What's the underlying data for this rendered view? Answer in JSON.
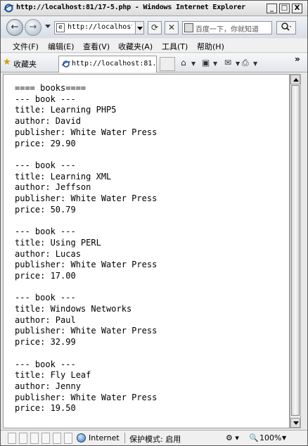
{
  "window": {
    "title": "http://localhost:81/17-5.php - Windows Internet Explorer",
    "controls": {
      "minimize": "_",
      "maximize": "□",
      "close": "X"
    }
  },
  "navigation": {
    "back_icon": "back-arrow-icon",
    "forward_icon": "forward-arrow-icon",
    "address_value": "http://localhost 8",
    "refresh_icon": "refresh-icon",
    "stop_icon": "stop-icon",
    "search_placeholder": "百度一下，你就知道",
    "search_icon": "magnifier-icon"
  },
  "menu": {
    "items": [
      "文件(F)",
      "编辑(E)",
      "查看(V)",
      "收藏夹(A)",
      "工具(T)",
      "帮助(H)"
    ]
  },
  "favorites_bar": {
    "favorites_label": "收藏夹",
    "tab_title": "http://localhost:81...",
    "more": "»"
  },
  "page": {
    "lines": [
      "==== books====",
      "--- book ---",
      "title: Learning PHP5",
      "author: David",
      "publisher: White Water Press",
      "price: 29.90",
      "",
      "--- book ---",
      "title: Learning XML",
      "author: Jeffson",
      "publisher: White Water Press",
      "price: 50.79",
      "",
      "--- book ---",
      "title: Using PERL",
      "author: Lucas",
      "publisher: White Water Press",
      "price: 17.00",
      "",
      "--- book ---",
      "title: Windows Networks",
      "author: Paul",
      "publisher: White Water Press",
      "price: 32.99",
      "",
      "--- book ---",
      "title: Fly Leaf",
      "author: Jenny",
      "publisher: White Water Press",
      "price: 19.50"
    ]
  },
  "status": {
    "zone": "Internet",
    "protected_mode": "保护模式: 启用",
    "zoom": "100%"
  }
}
